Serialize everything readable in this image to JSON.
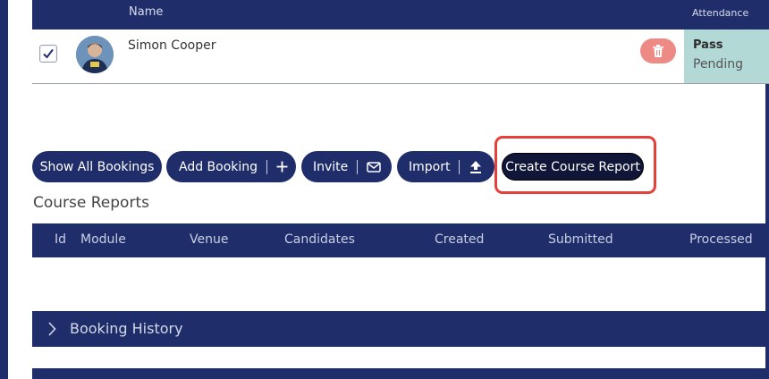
{
  "bookings_table": {
    "header": {
      "name": "Name",
      "attendance": "Attendance"
    },
    "rows": [
      {
        "name": "Simon Cooper",
        "selected": true,
        "attendance_status": "Pass",
        "attendance_sub": "Pending"
      }
    ]
  },
  "toolbar": {
    "show_all_bookings": "Show All Bookings",
    "add_booking": "Add Booking",
    "invite": "Invite",
    "import": "Import",
    "create_course_report": "Create Course Report"
  },
  "course_reports": {
    "title": "Course Reports",
    "columns": [
      "Id",
      "Module",
      "Venue",
      "Candidates",
      "Created",
      "Submitted",
      "Processed"
    ]
  },
  "booking_history": {
    "label": "Booking History"
  },
  "colors": {
    "navy": "#1f2d6b",
    "attendance_bg": "#b3d9d7",
    "delete_btn": "#ee8a86",
    "highlight": "#e5403c"
  }
}
